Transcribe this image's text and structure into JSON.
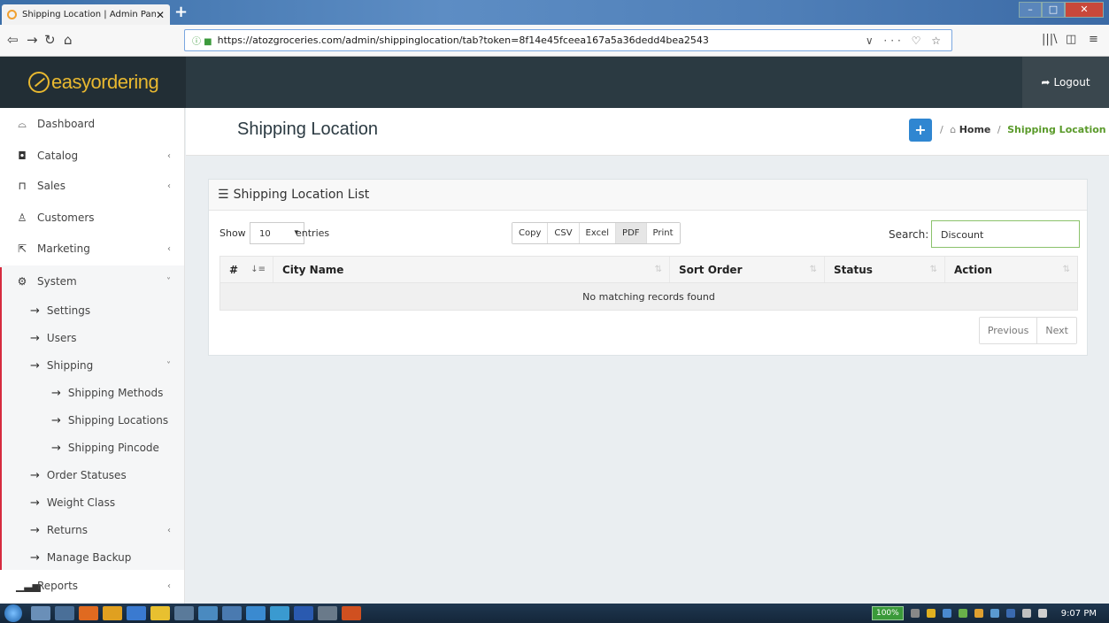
{
  "browser": {
    "tab_title": "Shipping Location | Admin Pan",
    "tab_close": "✕",
    "new_tab": "+",
    "url": "https://atozgroceries.com/admin/shippinglocation/tab?token=8f14e45fceea167a5a36dedd4bea2543",
    "url_actions": "∨ ··· ♡ ☆"
  },
  "app": {
    "logo_text": "easyordering",
    "logout_label": "Logout"
  },
  "sidebar": {
    "items": [
      {
        "label": "Dashboard",
        "icon": "dashboard-icon"
      },
      {
        "label": "Catalog",
        "icon": "tag-icon"
      },
      {
        "label": "Sales",
        "icon": "cart-icon"
      },
      {
        "label": "Customers",
        "icon": "user-icon"
      },
      {
        "label": "Marketing",
        "icon": "share-icon"
      },
      {
        "label": "System",
        "icon": "gear-icon"
      }
    ],
    "system_sub": [
      "Settings",
      "Users",
      "Shipping"
    ],
    "shipping_sub": [
      "Shipping Methods",
      "Shipping Locations",
      "Shipping Pincode"
    ],
    "system_sub2": [
      "Order Statuses",
      "Weight Class",
      "Returns",
      "Manage Backup"
    ],
    "reports": "Reports"
  },
  "page": {
    "title": "Shipping Location",
    "add_label": "+",
    "breadcrumb_home": "Home",
    "breadcrumb_sep": "/",
    "breadcrumb_current": "Shipping Location"
  },
  "panel": {
    "title": "Shipping Location List",
    "show_label": "Show",
    "entries_value": "10",
    "entries_label": "entries",
    "export_buttons": [
      "Copy",
      "CSV",
      "Excel",
      "PDF",
      "Print"
    ],
    "search_label": "Search:",
    "search_value": "Discount",
    "columns": [
      "#",
      "City Name",
      "Sort Order",
      "Status",
      "Action"
    ],
    "empty_message": "No matching records found",
    "prev_label": "Previous",
    "next_label": "Next"
  },
  "taskbar": {
    "zoom": "100%",
    "clock": "9:07 PM"
  },
  "colors": {
    "header_bg": "#2b3a42",
    "accent_gold": "#e8b830",
    "accent_blue": "#2f86d1",
    "accent_green": "#5a9a2a",
    "active_bar": "#d62b3f"
  }
}
